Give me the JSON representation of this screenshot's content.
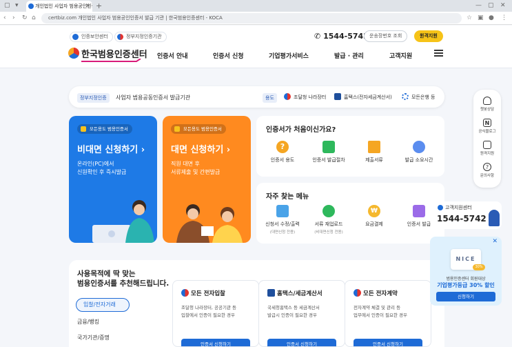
{
  "browser": {
    "tab_title": "개인법인 사업자 범용공인인증서 발급 기관 | 한국범용인증센터",
    "url": "certbiz.com  개인법인 사업자 범용공인인증서 발급 기관 | 한국범용인증센터 - KOCA"
  },
  "header": {
    "chip_cert": "인증보안센터",
    "chip_gov": "정부지정인증기관",
    "logo": "한국범용인증센터",
    "nav": [
      "인증서 안내",
      "인증서 신청",
      "기업평가서비스",
      "발급 · 관리",
      "고객지원"
    ],
    "phone": "1544-5742",
    "track_btn": "운송장번호 조회",
    "remote_btn": "원격지원"
  },
  "infobar": {
    "tag": "정부지정인증",
    "text": "사업자 범용공동인증서 발급기관",
    "use_tag": "용도",
    "uses": [
      "조달청 나라장터",
      "홈택스(전자세금계산서)",
      "모든은행 등"
    ]
  },
  "cards": {
    "blue": {
      "pill": "모든용도 범용인증서",
      "title": "비대면 신청하기 ›",
      "desc1": "온라인(PC)에서",
      "desc2": "신원확인 후 즉시발급"
    },
    "orange": {
      "pill": "모든용도 범용인증서",
      "title": "대면 신청하기 ›",
      "desc1": "직원 대면 후",
      "desc2": "서류제출 및 간편발급"
    }
  },
  "first_time": {
    "title": "인증서가 처음이신가요?",
    "items": [
      "인증서 용도",
      "인증서 발급절차",
      "제출서류",
      "발급 소요시간"
    ]
  },
  "faq": {
    "title": "자주 찾는 메뉴",
    "items": [
      {
        "label": "신청서 수정/출력",
        "sub": "(대면신청 전용)"
      },
      {
        "label": "서류 재업로드",
        "sub": "(비대면신청 전용)"
      },
      {
        "label": "요금결제",
        "sub": ""
      },
      {
        "label": "인증서 발급",
        "sub": ""
      }
    ]
  },
  "recommend": {
    "title1": "사용목적에 딱 맞는",
    "title2": "범용인증서를 추천해드립니다.",
    "categories": [
      "입찰/전자거래",
      "금융/뱅킹",
      "국가기관/증명"
    ],
    "cards": [
      {
        "title": "모든 전자입찰",
        "desc1": "조달청 나라장터, 공공기관 등",
        "desc2": "입찰에서 인증이 필요한 경우",
        "btn": "인증서 신청하기"
      },
      {
        "title": "홈택스/세금계산서",
        "desc1": "국세청홈택스 등 세금계산서",
        "desc2": "발급시 인증이 필요한 경우",
        "btn": "인증서 신청하기"
      },
      {
        "title": "모든 전자계약",
        "desc1": "전자계약 체결 및 관리 등",
        "desc2": "업무에서 인증이 필요한 경우",
        "btn": "인증서 신청하기"
      }
    ]
  },
  "sidebar": {
    "items": [
      {
        "label": "챗봇상담",
        "icon": "headset-icon"
      },
      {
        "label": "공식블로그",
        "icon": "blog-icon"
      },
      {
        "label": "원격지원",
        "icon": "monitor-icon"
      },
      {
        "label": "문의사항",
        "icon": "question-icon"
      }
    ]
  },
  "center": {
    "label": "고객지원센터",
    "phone": "1544-5742"
  },
  "ad": {
    "brand": "NICE",
    "badge": "30%",
    "desc": "범용인증센터 회원대상",
    "headline": "기업평가등급 30% 할인",
    "btn": "신청하기"
  },
  "colors": {
    "primary": "#1e6bd6",
    "orange": "#ff8a1f",
    "yellow": "#f6c318"
  }
}
